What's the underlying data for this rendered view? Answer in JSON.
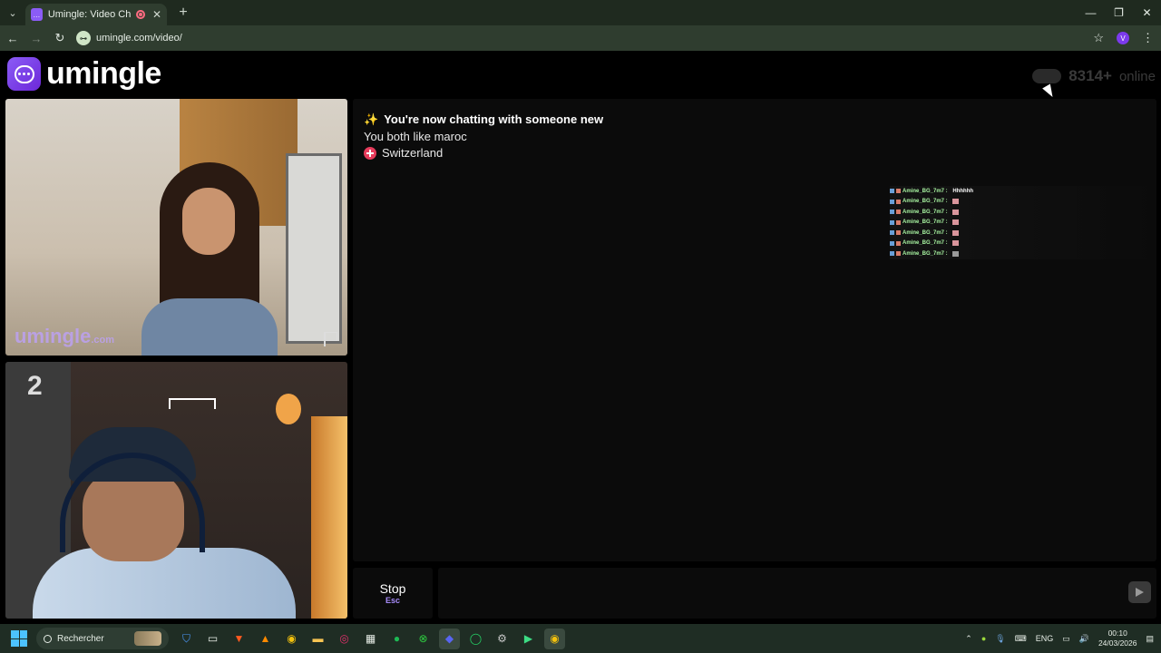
{
  "browser": {
    "tab_title": "Umingle: Video Chat with S",
    "url": "umingle.com/video/",
    "profile_initial": "V",
    "tab_menu_icon": "chevron-down-icon",
    "new_tab_label": "+",
    "window_controls": [
      "minimize-icon",
      "maximize-icon",
      "close-icon"
    ]
  },
  "header": {
    "logo_text": "umingle",
    "online_count": "8314+",
    "online_label": "online"
  },
  "videos": {
    "stranger_watermark": "umingle",
    "stranger_watermark_suffix": ".com",
    "self_poster_text": "2"
  },
  "chat": {
    "system_messages": {
      "new_chat": "You're now chatting with someone new",
      "common_interest": "You both like maroc",
      "country": "Switzerland"
    },
    "overlay_rows": [
      {
        "user": "Amine_BG_7m7 :",
        "msg": "Hhhhhh"
      },
      {
        "user": "Amine_BG_7m7 :",
        "msg": ""
      },
      {
        "user": "Amine_BG_7m7 :",
        "msg": ""
      },
      {
        "user": "Amine_BG_7m7 :",
        "msg": ""
      },
      {
        "user": "Amine_BG_7m7 :",
        "msg": ""
      },
      {
        "user": "Amine_BG_7m7 :",
        "msg": ""
      },
      {
        "user": "Amine_BG_7m7 :",
        "msg": ""
      }
    ],
    "stop_label": "Stop",
    "stop_key": "Esc",
    "input_value": "",
    "input_placeholder": ""
  },
  "taskbar": {
    "search_label": "Rechercher",
    "language": "ENG",
    "time": "00:10",
    "date": "24/03/2026"
  },
  "colors": {
    "brand": "#8b5cf6",
    "chrome": "#2f3d2f",
    "panel": "#0b0b0b"
  }
}
